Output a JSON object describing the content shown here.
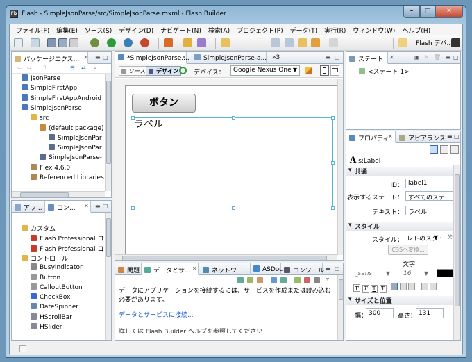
{
  "window": {
    "title": "Flash - SimpleJsonParse/src/SimpleJsonParse.mxml - Flash Builder",
    "app_icon": "Fb"
  },
  "menu": [
    "ファイル(F)",
    "編集(E)",
    "ソース(S)",
    "デザイン(D)",
    "ナビゲート(N)",
    "検索(A)",
    "プロジェクト(P)",
    "データ(T)",
    "実行(R)",
    "ウィンドウ(W)",
    "ヘルプ(H)"
  ],
  "perspective_label": "Flash デバ...",
  "package_explorer": {
    "tab": "パッケージエクス...",
    "items": [
      {
        "label": "JsonParse",
        "indent": 0,
        "icon": "project"
      },
      {
        "label": "SimpleFirstApp",
        "indent": 0,
        "icon": "project"
      },
      {
        "label": "SimpleFirstAppAndroid",
        "indent": 0,
        "icon": "project"
      },
      {
        "label": "SimpleJsonParse",
        "indent": 0,
        "icon": "project"
      },
      {
        "label": "src",
        "indent": 1,
        "icon": "folder"
      },
      {
        "label": "(default package)",
        "indent": 2,
        "icon": "package"
      },
      {
        "label": "SimpleJsonPar",
        "indent": 3,
        "icon": "file"
      },
      {
        "label": "SimpleJsonPar",
        "indent": 3,
        "icon": "file"
      },
      {
        "label": "SimpleJsonParse-",
        "indent": 2,
        "icon": "file"
      },
      {
        "label": "Flex 4.6.0",
        "indent": 1,
        "icon": "lib"
      },
      {
        "label": "Referenced Libraries",
        "indent": 1,
        "icon": "lib"
      }
    ]
  },
  "components": {
    "tabs": [
      "アウ...",
      "コン..."
    ],
    "items": [
      {
        "label": "カスタム",
        "indent": 0,
        "icon": "folder"
      },
      {
        "label": "Flash Professional コ",
        "indent": 1,
        "icon": "flash"
      },
      {
        "label": "Flash Professional コ",
        "indent": 1,
        "icon": "flash"
      },
      {
        "label": "コントロール",
        "indent": 0,
        "icon": "folder"
      },
      {
        "label": "BusyIndicator",
        "indent": 1,
        "icon": "busy"
      },
      {
        "label": "Button",
        "indent": 1,
        "icon": "button"
      },
      {
        "label": "CalloutButton",
        "indent": 1,
        "icon": "button"
      },
      {
        "label": "CheckBox",
        "indent": 1,
        "icon": "checkbox"
      },
      {
        "label": "DateSpinner",
        "indent": 1,
        "icon": "spinner"
      },
      {
        "label": "HScrollBar",
        "indent": 1,
        "icon": "scroll"
      },
      {
        "label": "HSlider",
        "indent": 1,
        "icon": "slider"
      }
    ]
  },
  "editor": {
    "tabs": [
      "*SimpleJsonParse....",
      "SimpleJsonParse-a...",
      "»3"
    ],
    "source_btn": "ソース",
    "design_btn": "デザイン",
    "device_label": "デバイス：",
    "device_value": "Google Nexus One",
    "canvas_button": "ボタン",
    "canvas_label": "ラベル"
  },
  "bottom": {
    "tabs": [
      "問題",
      "データとサ...",
      "ネットワー...",
      "ASDoc",
      "コンソール"
    ],
    "message": "データにアプリケーションを接続するには、サービスを作成または読み込む必要があります。",
    "link": "データとサービスに接続...",
    "cut_text": "詳しくは Flash Builder ヘルプを参照してください"
  },
  "states": {
    "tab": "ステート",
    "item": "<ステート 1>"
  },
  "properties": {
    "tabs": [
      "プロパティ",
      "アピアランス"
    ],
    "component": "s:Label",
    "sections": {
      "common": "共通",
      "style": "スタイル",
      "size": "サイズと位置"
    },
    "id_label": "ID：",
    "id_value": "label1",
    "state_label": "表示するステート：",
    "state_value": "すべてのステート",
    "text_label": "テキスト：",
    "text_value": "ラベル",
    "style_label": "スタイル：",
    "style_value": "レトのスタイル>",
    "css_button": "CSSへ変換...",
    "text_group": "文字",
    "font_value": "_sans",
    "font_size": "16",
    "width_label": "幅：",
    "width_value": "300",
    "height_label": "高さ：",
    "height_value": "131"
  }
}
